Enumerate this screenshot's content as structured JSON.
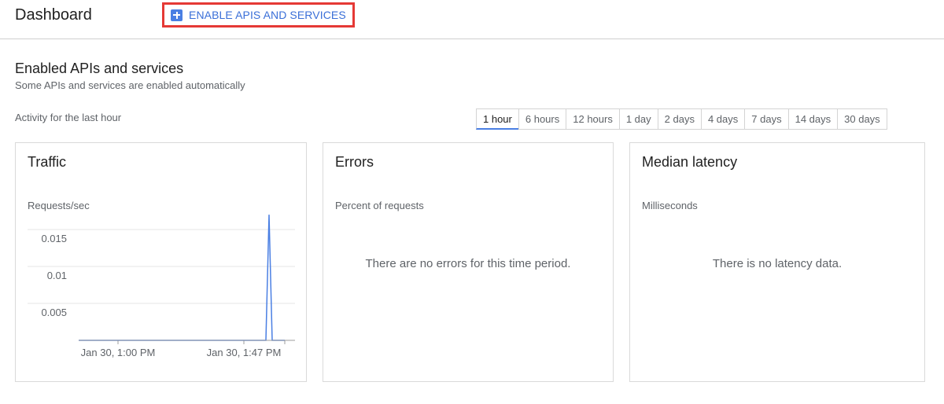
{
  "header": {
    "title": "Dashboard",
    "enable_button": "ENABLE APIS AND SERVICES",
    "enable_icon": "plus-icon"
  },
  "section": {
    "title": "Enabled APIs and services",
    "subtitle": "Some APIs and services are enabled automatically",
    "activity_label": "Activity for the last hour"
  },
  "time_ranges": [
    "1 hour",
    "6 hours",
    "12 hours",
    "1 day",
    "2 days",
    "4 days",
    "7 days",
    "14 days",
    "30 days"
  ],
  "selected_range": "1 hour",
  "cards": {
    "traffic": {
      "title": "Traffic",
      "metric": "Requests/sec"
    },
    "errors": {
      "title": "Errors",
      "metric": "Percent of requests",
      "empty": "There are no errors for this time period."
    },
    "latency": {
      "title": "Median latency",
      "metric": "Milliseconds",
      "empty": "There is no latency data."
    }
  },
  "colors": {
    "accent": "#4a7fe3",
    "highlight_border": "#e53935",
    "line": "#4a7fe3"
  },
  "chart_data": {
    "type": "line",
    "ylabel": "Requests/sec",
    "ylim": [
      0,
      0.015
    ],
    "y_ticks": [
      "0.015",
      "0.01",
      "0.005"
    ],
    "x_ticks": [
      "Jan 30, 1:00 PM",
      "Jan 30, 1:47 PM"
    ],
    "x": [
      "12:54 PM",
      "1:00 PM",
      "1:44 PM",
      "1:45 PM",
      "1:46 PM",
      "1:47 PM"
    ],
    "values": [
      0,
      0,
      0,
      0.017,
      0,
      0
    ]
  }
}
